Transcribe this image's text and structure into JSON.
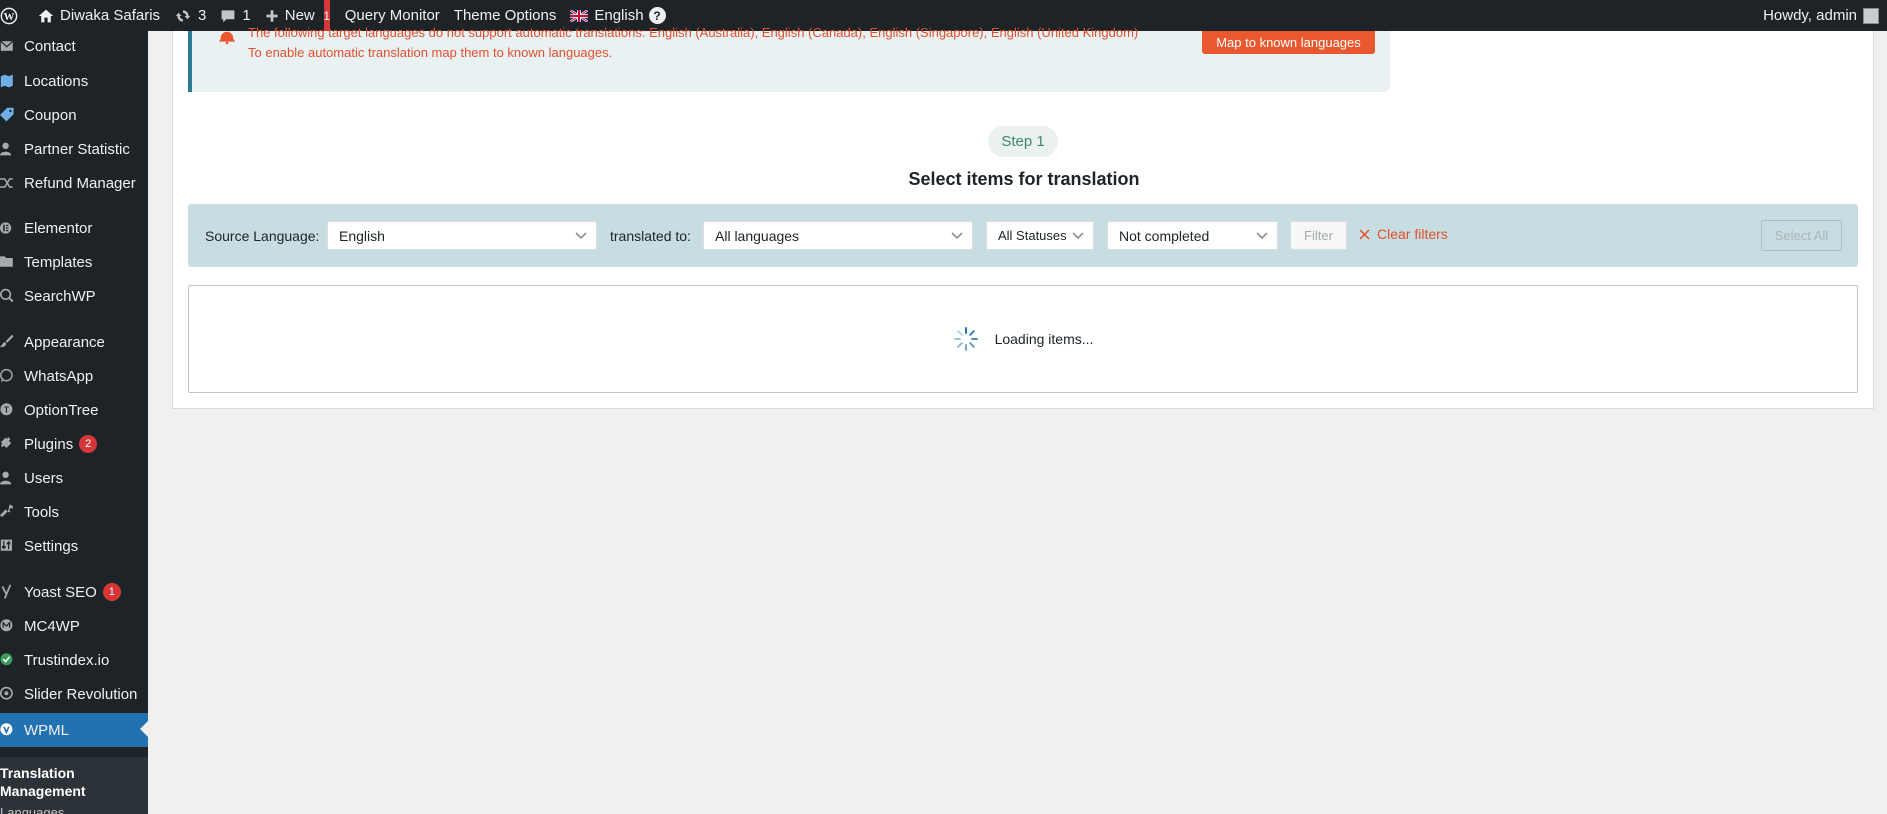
{
  "adminbar": {
    "site_name": "Diwaka Safaris",
    "updates_count": "3",
    "comments_count": "1",
    "new_label": "New",
    "alert_count": "1",
    "query_monitor": "Query Monitor",
    "theme_options": "Theme Options",
    "language": "English",
    "help": "?",
    "greeting": "Howdy, admin"
  },
  "sidebar": {
    "items": [
      {
        "label": "Contact"
      },
      {
        "label": "Locations"
      },
      {
        "label": "Coupon"
      },
      {
        "label": "Partner Statistic"
      },
      {
        "label": "Refund Manager"
      },
      {
        "label": "Elementor"
      },
      {
        "label": "Templates"
      },
      {
        "label": "SearchWP"
      },
      {
        "label": "Appearance"
      },
      {
        "label": "WhatsApp"
      },
      {
        "label": "OptionTree"
      },
      {
        "label": "Plugins",
        "badge": "2"
      },
      {
        "label": "Users"
      },
      {
        "label": "Tools"
      },
      {
        "label": "Settings"
      },
      {
        "label": "Yoast SEO",
        "badge": "1"
      },
      {
        "label": "MC4WP"
      },
      {
        "label": "Trustindex.io"
      },
      {
        "label": "Slider Revolution"
      },
      {
        "label": "WPML"
      }
    ],
    "submenu_current": "Translation Management",
    "submenu_next": "Languages"
  },
  "notice": {
    "line1": "The following target languages do not support automatic translations: English (Australia), English (Canada), English (Singapore), English (United Kingdom)",
    "line2": "To enable automatic translation map them to known languages.",
    "button": "Map to known languages"
  },
  "step": {
    "pill": "Step 1",
    "title": "Select items for translation"
  },
  "filters": {
    "source_label": "Source Language:",
    "source_value": "English",
    "target_label": "translated to:",
    "target_value": "All languages",
    "status_value": "All Statuses",
    "completion_value": "Not completed",
    "filter_button": "Filter",
    "clear_filters": "Clear filters",
    "select_all": "Select All"
  },
  "results": {
    "loading_text": "Loading items..."
  },
  "colors": {
    "adminbar_bg": "#1d2327",
    "active_menu": "#2271b1",
    "accent_orange": "#e9582e",
    "filterbar_bg": "#c8dde2"
  }
}
